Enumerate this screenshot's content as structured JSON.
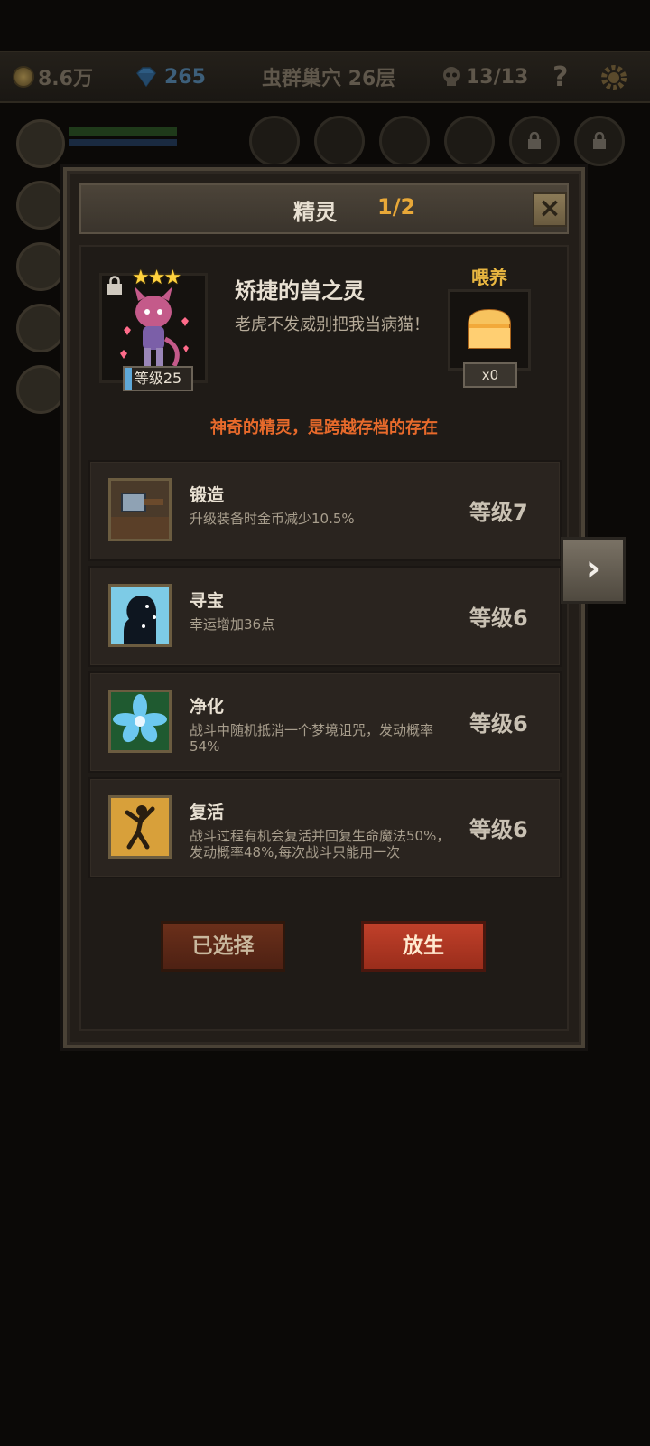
{
  "topbar": {
    "gold": "8.6万",
    "gems": "265",
    "location": "虫群巢穴 26层",
    "kills": "13/13",
    "help_label": "?"
  },
  "dialog": {
    "title": "精灵",
    "page_count": "1/2",
    "close_label": "×",
    "pet": {
      "stars": "★★★",
      "name": "矫捷的兽之灵",
      "description": "老虎不发威别把我当病猫！",
      "level": "等级25",
      "feed_label": "喂养",
      "feed_count": "x0",
      "tagline": "神奇的精灵，是跨越存档的存在"
    },
    "skills": [
      {
        "name": "锻造",
        "desc": "升级装备时金币减少10.5%",
        "level": "等级7",
        "icon": "hammer-icon"
      },
      {
        "name": "寻宝",
        "desc": "幸运增加36点",
        "level": "等级6",
        "icon": "silhouette-sparkle-icon"
      },
      {
        "name": "净化",
        "desc": "战斗中随机抵消一个梦境诅咒，发动概率54%",
        "level": "等级6",
        "icon": "blue-flower-icon"
      },
      {
        "name": "复活",
        "desc": "战斗过程有机会复活并回复生命魔法50%，发动概率48%,每次战斗只能用一次",
        "level": "等级6",
        "icon": "dancing-figure-icon"
      }
    ],
    "buttons": {
      "selected": "已选择",
      "release": "放生"
    },
    "next_label": "›"
  }
}
